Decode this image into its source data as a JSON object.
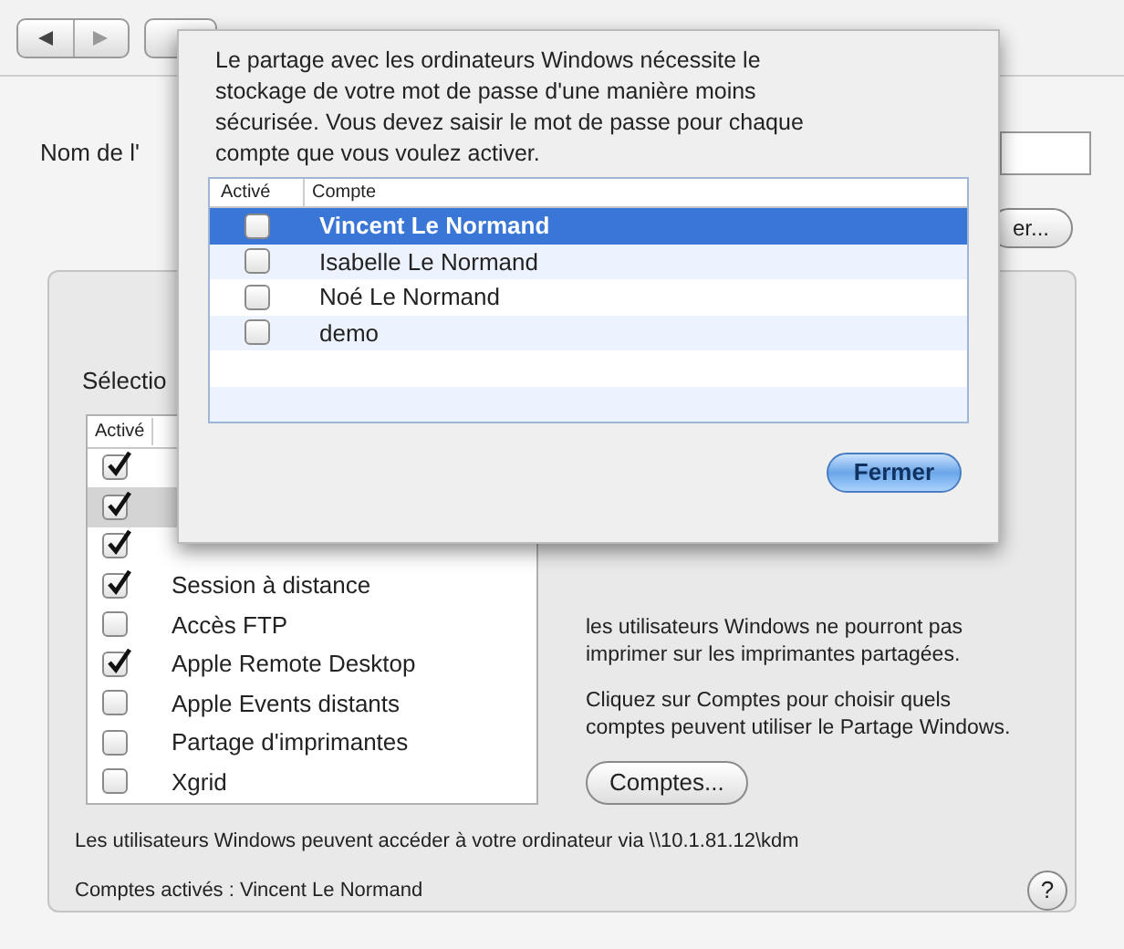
{
  "window": {
    "name_label": "Nom de l'",
    "edit_button": "er..."
  },
  "services": {
    "title": "Sélectio",
    "column": "Activé",
    "items": [
      {
        "checked": true,
        "selected": false
      },
      {
        "checked": true,
        "selected": true
      },
      {
        "checked": true,
        "selected": false
      },
      {
        "name": "Session à distance",
        "checked": true,
        "selected": false
      },
      {
        "name": "Accès FTP",
        "checked": false,
        "selected": false
      },
      {
        "name": "Apple Remote Desktop",
        "checked": true,
        "selected": false
      },
      {
        "name": "Apple Events distants",
        "checked": false,
        "selected": false
      },
      {
        "name": "Partage d'imprimantes",
        "checked": false,
        "selected": false
      },
      {
        "name": "Xgrid",
        "checked": false,
        "selected": false
      }
    ]
  },
  "description": [
    "les utilisateurs Windows ne pourront pas imprimer sur les imprimantes partagées.",
    "Cliquez sur Comptes pour choisir quels comptes peuvent utiliser le Partage Windows."
  ],
  "accounts_button": "Comptes...",
  "address_note": "Les utilisateurs Windows peuvent accéder à votre ordinateur via \\\\10.1.81.12\\kdm",
  "enabled_accounts": "Comptes activés : Vincent Le Normand",
  "help_button": "?",
  "sheet": {
    "message": "Le partage avec les ordinateurs Windows nécessite le stockage de votre mot de passe d'une manière moins sécurisée. Vous devez saisir le mot de passe pour chaque compte que vous voulez activer.",
    "columns": [
      "Activé",
      "Compte"
    ],
    "accounts": [
      {
        "name": "Vincent Le Normand",
        "checked": false,
        "selected": true
      },
      {
        "name": "Isabelle Le Normand",
        "checked": false,
        "selected": false
      },
      {
        "name": "Noé Le Normand",
        "checked": false,
        "selected": false
      },
      {
        "name": "demo",
        "checked": false,
        "selected": false
      }
    ],
    "close_button": "Fermer"
  }
}
